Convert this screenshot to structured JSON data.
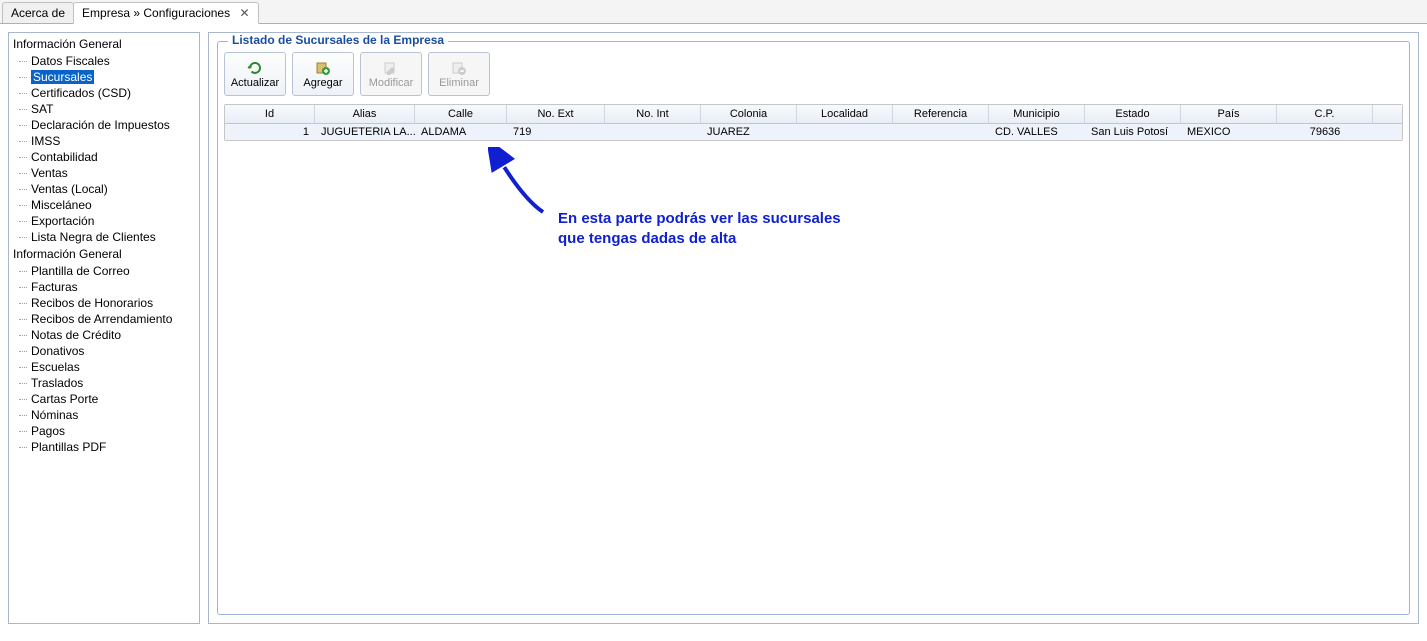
{
  "tabs": [
    {
      "label": "Acerca de",
      "active": false,
      "closable": false
    },
    {
      "label": "Empresa » Configuraciones",
      "active": true,
      "closable": true
    }
  ],
  "close_glyph": "✕",
  "tree": {
    "groups": [
      {
        "label": "Información General",
        "items": [
          {
            "label": "Datos Fiscales",
            "selected": false
          },
          {
            "label": "Sucursales",
            "selected": true
          },
          {
            "label": "Certificados (CSD)",
            "selected": false
          },
          {
            "label": "SAT",
            "selected": false
          },
          {
            "label": "Declaración de Impuestos",
            "selected": false
          },
          {
            "label": "IMSS",
            "selected": false
          },
          {
            "label": "Contabilidad",
            "selected": false
          },
          {
            "label": "Ventas",
            "selected": false
          },
          {
            "label": "Ventas (Local)",
            "selected": false
          },
          {
            "label": "Misceláneo",
            "selected": false
          },
          {
            "label": "Exportación",
            "selected": false
          },
          {
            "label": "Lista Negra de Clientes",
            "selected": false
          }
        ]
      },
      {
        "label": "Información General",
        "items": [
          {
            "label": "Plantilla de Correo",
            "selected": false
          },
          {
            "label": "Facturas",
            "selected": false
          },
          {
            "label": "Recibos de Honorarios",
            "selected": false
          },
          {
            "label": "Recibos de Arrendamiento",
            "selected": false
          },
          {
            "label": "Notas de Crédito",
            "selected": false
          },
          {
            "label": "Donativos",
            "selected": false
          },
          {
            "label": "Escuelas",
            "selected": false
          },
          {
            "label": "Traslados",
            "selected": false
          },
          {
            "label": "Cartas Porte",
            "selected": false
          },
          {
            "label": "Nóminas",
            "selected": false
          },
          {
            "label": "Pagos",
            "selected": false
          },
          {
            "label": "Plantillas PDF",
            "selected": false
          }
        ]
      }
    ]
  },
  "main": {
    "groupbox_title": "Listado de Sucursales de la Empresa",
    "toolbar": {
      "actualizar": "Actualizar",
      "agregar": "Agregar",
      "modificar": "Modificar",
      "eliminar": "Eliminar"
    },
    "grid": {
      "headers": [
        "Id",
        "Alias",
        "Calle",
        "No. Ext",
        "No. Int",
        "Colonia",
        "Localidad",
        "Referencia",
        "Municipio",
        "Estado",
        "País",
        "C.P."
      ],
      "rows": [
        {
          "id": "1",
          "alias": "JUGUETERIA LA...",
          "calle": "ALDAMA",
          "no_ext": "719",
          "no_int": "",
          "colonia": "JUAREZ",
          "localidad": "",
          "referencia": "",
          "municipio": "CD. VALLES",
          "estado": "San Luis Potosí",
          "pais": "MEXICO",
          "cp": "79636"
        }
      ]
    }
  },
  "annotation": {
    "line1": "En esta parte podrás ver las sucursales",
    "line2": "que tengas dadas de alta"
  }
}
